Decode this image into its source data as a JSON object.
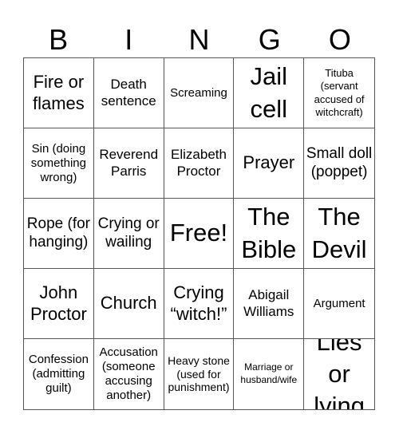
{
  "header": {
    "letters": [
      "B",
      "I",
      "N",
      "G",
      "O"
    ]
  },
  "cells": [
    {
      "text": "Fire or flames",
      "size": "s-l"
    },
    {
      "text": "Death sentence",
      "size": "s-md"
    },
    {
      "text": "Screaming",
      "size": "s-s"
    },
    {
      "text": "Jail cell",
      "size": "s-xl"
    },
    {
      "text": "Tituba (servant accused of witchcraft)",
      "size": "s-xxs"
    },
    {
      "text": "Sin (doing something wrong)",
      "size": "s-s"
    },
    {
      "text": "Reverend Parris",
      "size": "s-md"
    },
    {
      "text": "Elizabeth Proctor",
      "size": "s-md"
    },
    {
      "text": "Prayer",
      "size": "s-l"
    },
    {
      "text": "Small doll (poppet)",
      "size": "s-m"
    },
    {
      "text": "Rope (for hanging)",
      "size": "s-m"
    },
    {
      "text": "Crying or wailing",
      "size": "s-m"
    },
    {
      "text": "Free!",
      "size": "s-xl"
    },
    {
      "text": "The Bible",
      "size": "s-xl"
    },
    {
      "text": "The Devil",
      "size": "s-xl"
    },
    {
      "text": "John Proctor",
      "size": "s-l"
    },
    {
      "text": "Church",
      "size": "s-l"
    },
    {
      "text": "Crying “witch!”",
      "size": "s-l"
    },
    {
      "text": "Abigail Williams",
      "size": "s-md"
    },
    {
      "text": "Argument",
      "size": "s-s"
    },
    {
      "text": "Confession (admitting guilt)",
      "size": "s-s"
    },
    {
      "text": "Accusation (someone accusing another)",
      "size": "s-s"
    },
    {
      "text": "Heavy stone (used for punishment)",
      "size": "s-xs"
    },
    {
      "text": "Marriage or husband/wife",
      "size": "s-tiny"
    },
    {
      "text": "Lies or lying",
      "size": "s-xl"
    }
  ]
}
